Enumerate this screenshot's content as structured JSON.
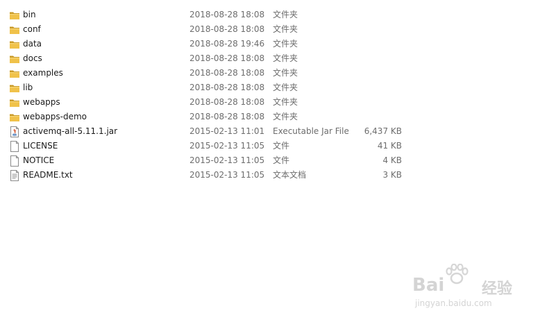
{
  "files": [
    {
      "name": "bin",
      "modified": "2018-08-28 18:08",
      "type": "文件夹",
      "size": "",
      "icon": "folder-icon"
    },
    {
      "name": "conf",
      "modified": "2018-08-28 18:08",
      "type": "文件夹",
      "size": "",
      "icon": "folder-icon"
    },
    {
      "name": "data",
      "modified": "2018-08-28 19:46",
      "type": "文件夹",
      "size": "",
      "icon": "folder-icon"
    },
    {
      "name": "docs",
      "modified": "2018-08-28 18:08",
      "type": "文件夹",
      "size": "",
      "icon": "folder-icon"
    },
    {
      "name": "examples",
      "modified": "2018-08-28 18:08",
      "type": "文件夹",
      "size": "",
      "icon": "folder-icon"
    },
    {
      "name": "lib",
      "modified": "2018-08-28 18:08",
      "type": "文件夹",
      "size": "",
      "icon": "folder-icon"
    },
    {
      "name": "webapps",
      "modified": "2018-08-28 18:08",
      "type": "文件夹",
      "size": "",
      "icon": "folder-icon"
    },
    {
      "name": "webapps-demo",
      "modified": "2018-08-28 18:08",
      "type": "文件夹",
      "size": "",
      "icon": "folder-icon"
    },
    {
      "name": "activemq-all-5.11.1.jar",
      "modified": "2015-02-13 11:01",
      "type": "Executable Jar File",
      "size": "6,437 KB",
      "icon": "jar-file-icon"
    },
    {
      "name": "LICENSE",
      "modified": "2015-02-13 11:05",
      "type": "文件",
      "size": "41 KB",
      "icon": "blank-file-icon"
    },
    {
      "name": "NOTICE",
      "modified": "2015-02-13 11:05",
      "type": "文件",
      "size": "4 KB",
      "icon": "blank-file-icon"
    },
    {
      "name": "README.txt",
      "modified": "2015-02-13 11:05",
      "type": "文本文档",
      "size": "3 KB",
      "icon": "text-file-icon"
    }
  ],
  "watermark": {
    "brand": "Bai",
    "brand_suffix": "经验",
    "url": "jingyan.baidu.com"
  },
  "colors": {
    "folder": "#e8b83a",
    "folder_dark": "#c99a26",
    "meta_text": "#6d6d6d",
    "watermark": "#d4d4d4"
  }
}
